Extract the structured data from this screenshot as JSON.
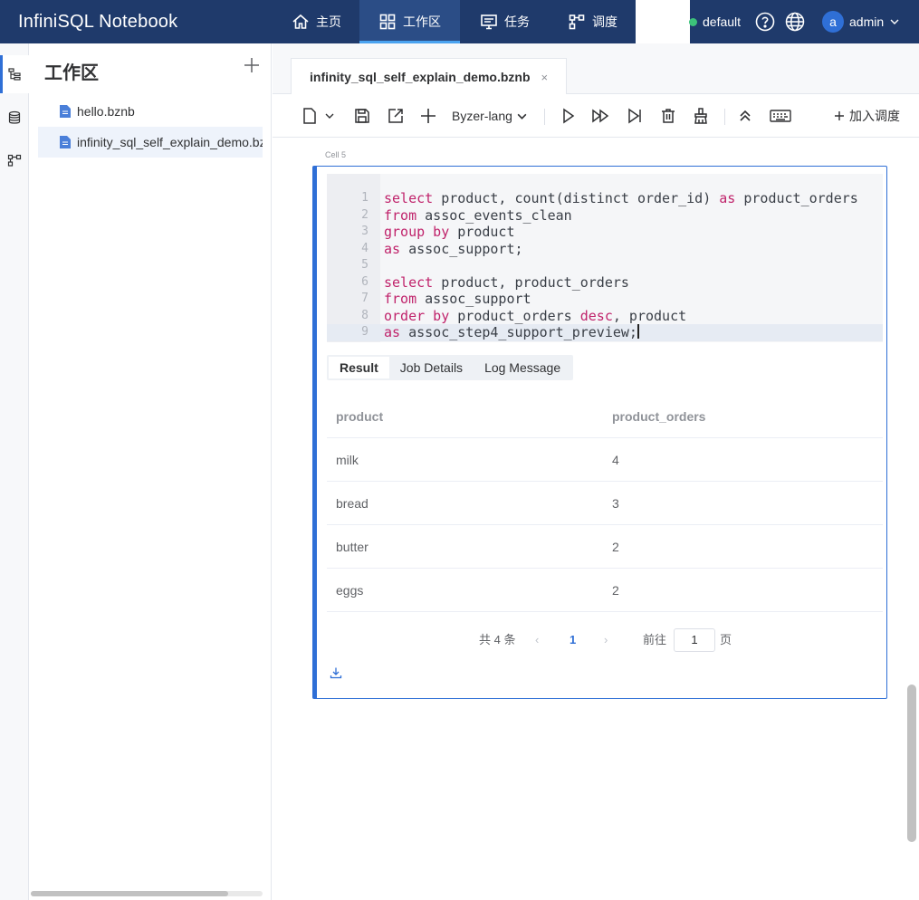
{
  "app": {
    "title": "InfiniSQL Notebook"
  },
  "nav": {
    "items": [
      {
        "label": "主页",
        "icon": "home-icon"
      },
      {
        "label": "工作区",
        "icon": "grid-icon"
      },
      {
        "label": "任务",
        "icon": "monitor-icon"
      },
      {
        "label": "调度",
        "icon": "flow-icon"
      }
    ],
    "active": "工作区"
  },
  "header": {
    "env": "default",
    "user_initial": "a",
    "user_name": "admin"
  },
  "sidebar": {
    "title": "工作区",
    "files": [
      {
        "name": "hello.bznb"
      },
      {
        "name": "infinity_sql_self_explain_demo.bznb"
      }
    ]
  },
  "editor": {
    "tab": "infinity_sql_self_explain_demo.bznb",
    "tab_close": "×",
    "language": "Byzer-lang",
    "schedule_label": "加入调度"
  },
  "cell": {
    "label": "Cell 5",
    "code_lines": [
      {
        "n": "1",
        "kw1": "select",
        "t1": " product, count(distinct order_id) ",
        "kw2": "as",
        "t2": " product_orders"
      },
      {
        "n": "2",
        "kw1": "from",
        "t1": " assoc_events_clean",
        "kw2": "",
        "t2": ""
      },
      {
        "n": "3",
        "kw1": "group by",
        "t1": " product",
        "kw2": "",
        "t2": ""
      },
      {
        "n": "4",
        "kw1": "as",
        "t1": " assoc_support;",
        "kw2": "",
        "t2": ""
      },
      {
        "n": "5",
        "kw1": "",
        "t1": "",
        "kw2": "",
        "t2": ""
      },
      {
        "n": "6",
        "kw1": "select",
        "t1": " product, product_orders",
        "kw2": "",
        "t2": ""
      },
      {
        "n": "7",
        "kw1": "from",
        "t1": " assoc_support",
        "kw2": "",
        "t2": ""
      },
      {
        "n": "8",
        "kw1": "order by",
        "t1": " product_orders ",
        "kw2": "desc",
        "t2": ", product"
      },
      {
        "n": "9",
        "kw1": "as",
        "t1": " assoc_step4_support_preview;",
        "kw2": "",
        "t2": ""
      }
    ],
    "result_tabs": [
      "Result",
      "Job Details",
      "Log Message"
    ],
    "active_result_tab": "Result",
    "table": {
      "columns": [
        "product",
        "product_orders"
      ],
      "rows": [
        [
          "milk",
          "4"
        ],
        [
          "bread",
          "3"
        ],
        [
          "butter",
          "2"
        ],
        [
          "eggs",
          "2"
        ]
      ]
    },
    "pagination": {
      "total_text": "共 4 条",
      "prev": "‹",
      "current_page": "1",
      "next": "›",
      "goto_label": "前往",
      "goto_value": "1",
      "page_suffix": "页"
    }
  },
  "colors": {
    "nav_bg": "#1f3a6b",
    "accent": "#2f6fd6",
    "keyword": "#c0236b",
    "env_status": "#3cc27a"
  }
}
